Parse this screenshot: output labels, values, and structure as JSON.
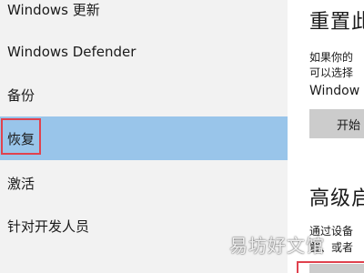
{
  "sidebar": {
    "items": [
      {
        "label": "Windows 更新",
        "selected": false
      },
      {
        "label": "Windows Defender",
        "selected": false
      },
      {
        "label": "备份",
        "selected": false
      },
      {
        "label": "恢复",
        "selected": true
      },
      {
        "label": "激活",
        "selected": false
      },
      {
        "label": "针对开发人员",
        "selected": false
      }
    ]
  },
  "main": {
    "reset_section": {
      "heading": "重置此",
      "desc_line1": "如果你的",
      "desc_line2": "可以选择",
      "desc_line3": "Window",
      "button_label": "开始"
    },
    "advanced_section": {
      "heading": "高级启",
      "desc_line1": "通过设备",
      "desc_line2": "置、或者"
    }
  },
  "watermark": "易坊好文馆",
  "colors": {
    "sidebar_bg": "#f2f2f2",
    "selected_bg": "#99c5ea",
    "highlight_border": "#e0424e",
    "button_bg": "#cccccc"
  }
}
